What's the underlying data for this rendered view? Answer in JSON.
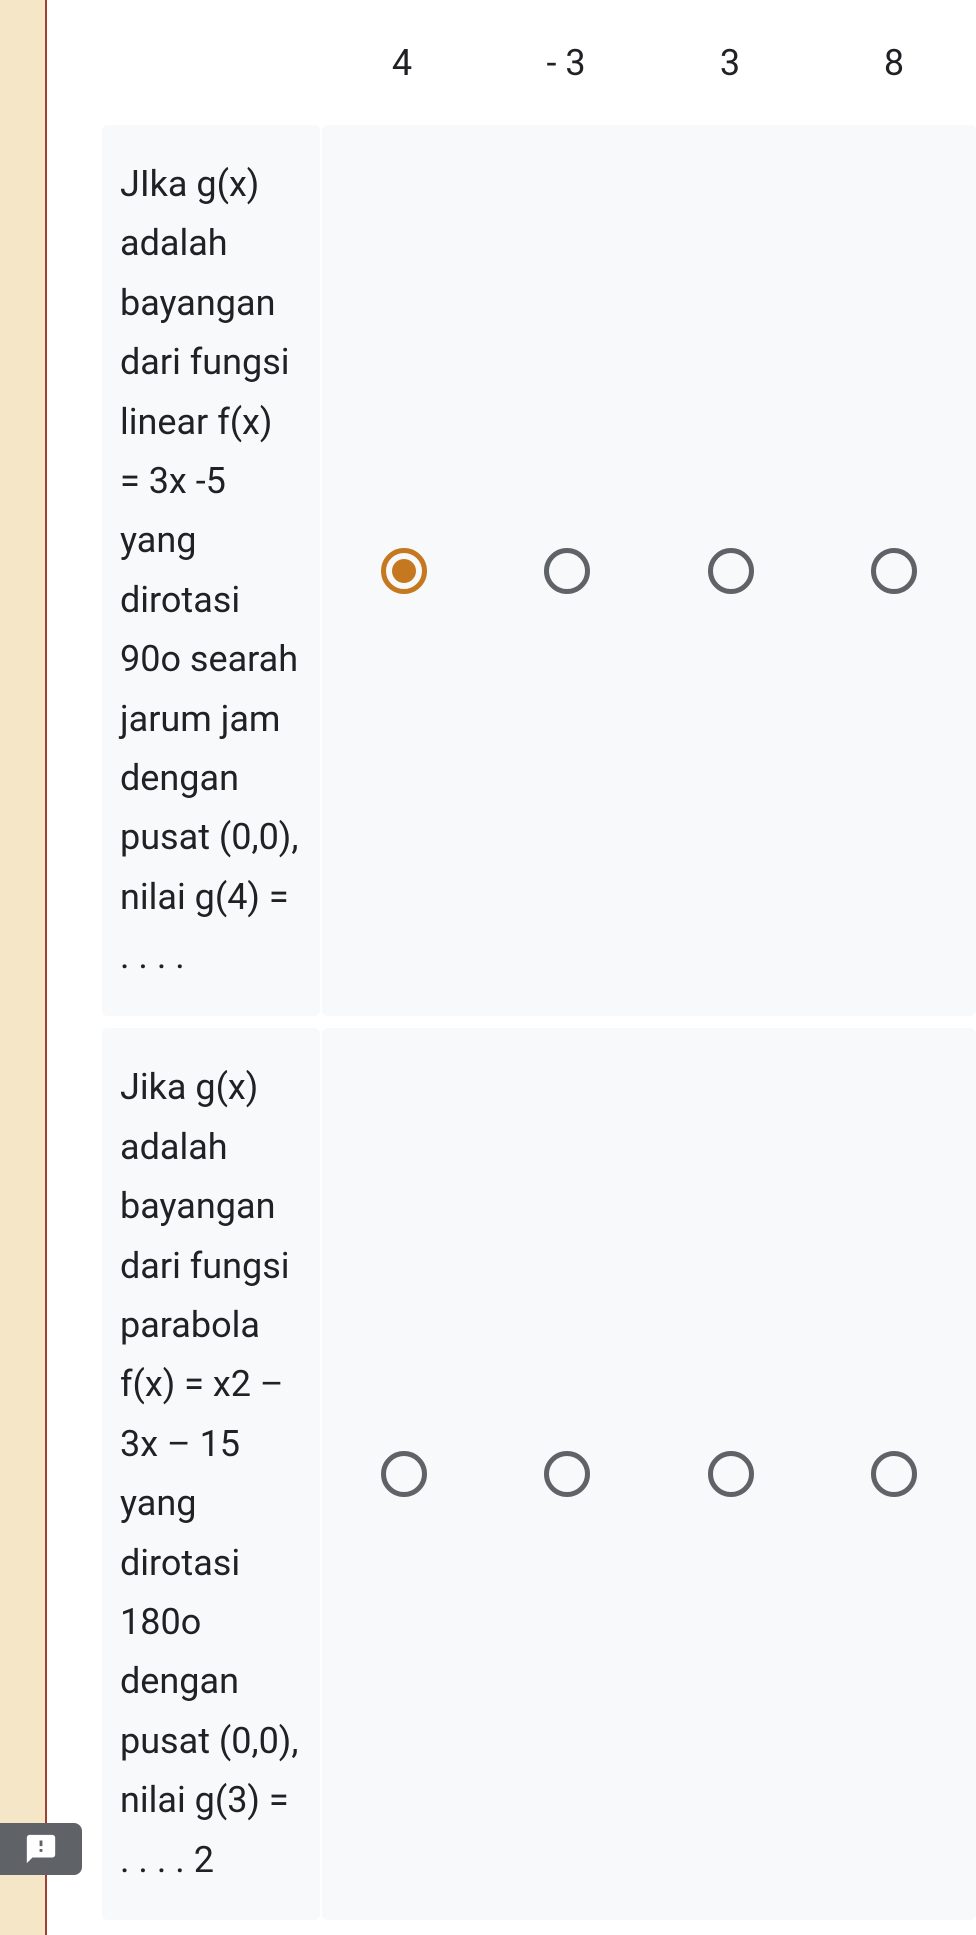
{
  "header": {
    "options": [
      "4",
      "- 3",
      "3",
      "8"
    ]
  },
  "rows": [
    {
      "question": "JIka g(x) adalah bayangan dari fungsi linear f(x) = 3x -5 yang dirotasi 90o searah jarum jam dengan pusat (0,0), nilai g(4) = . . . .",
      "selected": 0
    },
    {
      "question": "Jika g(x) adalah bayangan dari fungsi parabola  f(x)  = x2 – 3x – 15 yang dirotasi 180o dengan pusat (0,0), nilai g(3) = . . . . 2",
      "selected": -1
    }
  ]
}
